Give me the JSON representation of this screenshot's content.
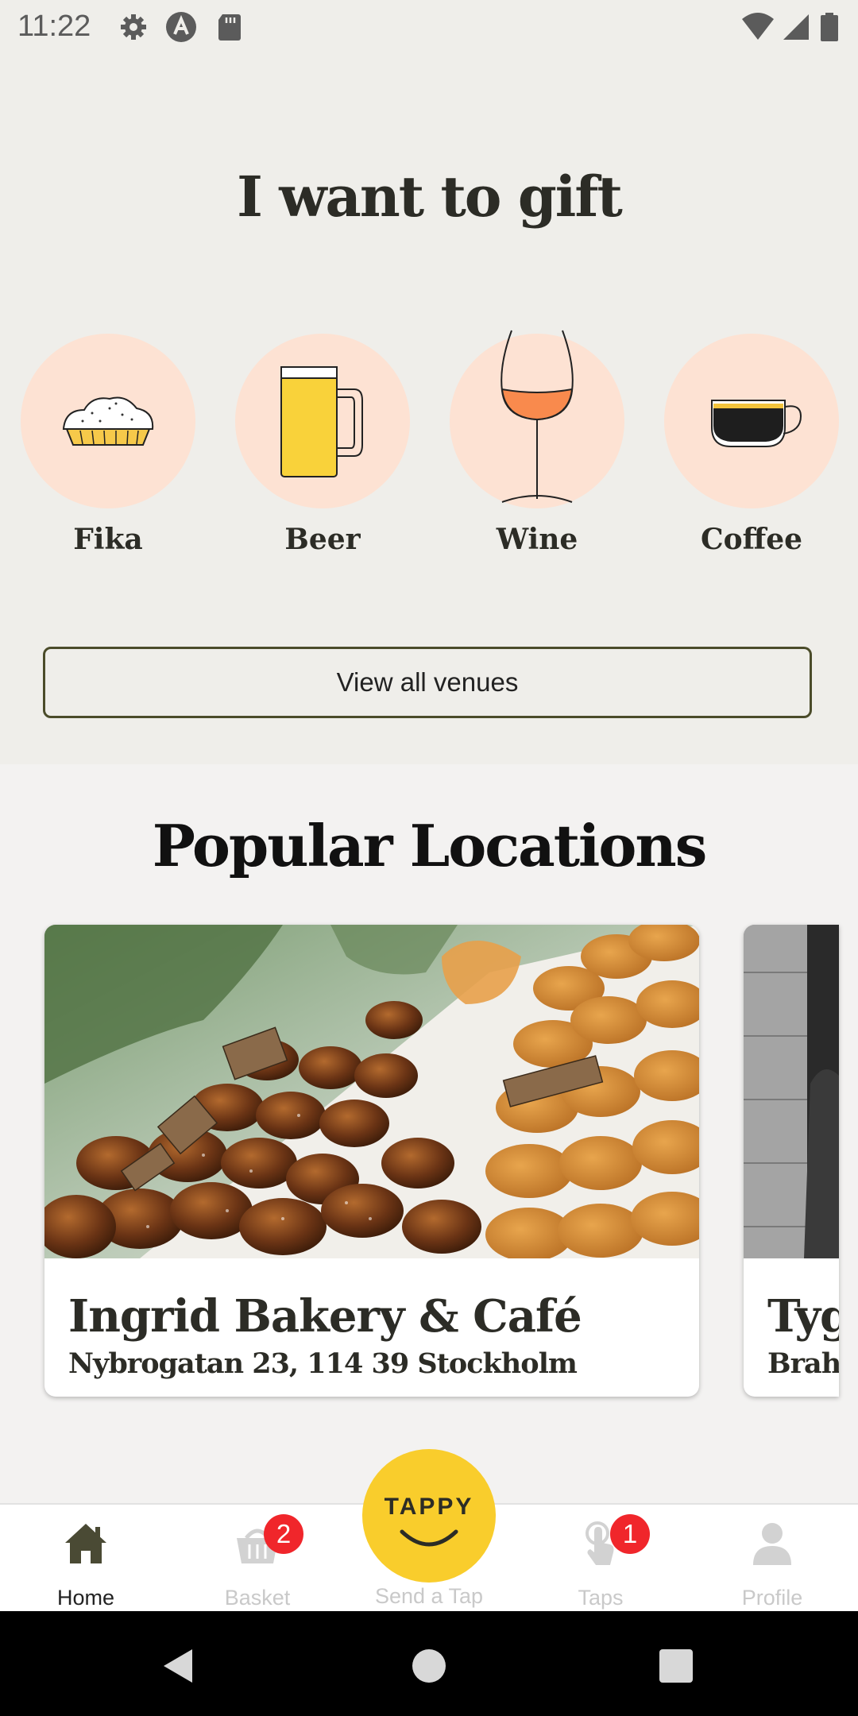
{
  "status_bar": {
    "time": "11:22"
  },
  "hero": {
    "title": "I want to gift",
    "categories": [
      {
        "label": "Fika",
        "icon": "bun-icon"
      },
      {
        "label": "Beer",
        "icon": "beer-mug-icon"
      },
      {
        "label": "Wine",
        "icon": "wine-glass-icon"
      },
      {
        "label": "Coffee",
        "icon": "coffee-cup-icon"
      }
    ],
    "view_all_label": "View all venues"
  },
  "popular": {
    "title": "Popular Locations",
    "cards": [
      {
        "name": "Ingrid Bakery & Café",
        "address": "Nybrogatan 23, 114 39 Stockholm"
      },
      {
        "name": "Tyg",
        "address": "Brah"
      }
    ]
  },
  "tabbar": {
    "home": "Home",
    "basket": "Basket",
    "basket_badge": "2",
    "send": "Send a Tap",
    "tappy": "TAPPY",
    "taps": "Taps",
    "taps_badge": "1",
    "profile": "Profile"
  },
  "colors": {
    "accent_yellow": "#f9cd2c",
    "circle_peach": "#fde2d3",
    "badge_red": "#f0262b"
  }
}
